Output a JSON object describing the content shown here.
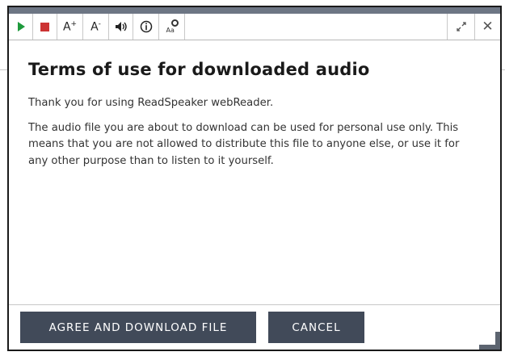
{
  "toolbar": {
    "increase_font_label": "A",
    "increase_font_sup": "+",
    "decrease_font_label": "A",
    "decrease_font_sup": "-",
    "speaker_glyph": "🔈",
    "info_glyph": "ⓘ",
    "aa_label": "Aa",
    "expand_glyph": "⤢",
    "close_glyph": "✕",
    "icons": {
      "play": "play-icon",
      "stop": "stop-icon",
      "increase_font": "font-increase-icon",
      "decrease_font": "font-decrease-icon",
      "volume": "volume-icon",
      "info": "info-icon",
      "text_settings": "text-settings-icon",
      "expand": "expand-icon",
      "close": "close-icon"
    },
    "colors": {
      "play": "#1e9a3c",
      "stop": "#cc3333",
      "topbar": "#6d7684"
    }
  },
  "dialog": {
    "title": "Terms of use for downloaded audio",
    "paragraphs": [
      "Thank you for using ReadSpeaker webReader.",
      "The audio file you are about to download can be used for personal use only. This means that you are not allowed to distribute this file to anyone else, or use it for any other purpose than to listen to it yourself."
    ]
  },
  "footer": {
    "agree_label": "AGREE AND DOWNLOAD FILE",
    "cancel_label": "CANCEL",
    "button_color": "#414a59"
  }
}
